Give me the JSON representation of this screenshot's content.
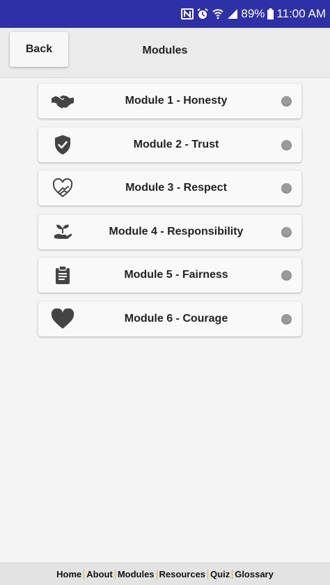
{
  "status_bar": {
    "battery": "89%",
    "time": "11:00 AM",
    "icons": [
      "nfc-icon",
      "alarm-icon",
      "wifi-icon",
      "signal-icon",
      "battery-icon"
    ]
  },
  "header": {
    "back_label": "Back",
    "title": "Modules"
  },
  "modules": [
    {
      "label": "Module 1 - Honesty",
      "icon": "handshake-icon"
    },
    {
      "label": "Module 2 - Trust",
      "icon": "shield-check-icon"
    },
    {
      "label": "Module 3 - Respect",
      "icon": "heart-hand-icon"
    },
    {
      "label": "Module 4 - Responsibility",
      "icon": "sprout-hand-icon"
    },
    {
      "label": "Module 5 - Fairness",
      "icon": "clipboard-icon"
    },
    {
      "label": "Module 6 - Courage",
      "icon": "heart-icon"
    }
  ],
  "footer": {
    "links": [
      "Home",
      "About",
      "Modules",
      "Resources",
      "Quiz",
      "Glossary"
    ]
  },
  "colors": {
    "status_bar": "#2e30a8",
    "icon": "#444444",
    "status_dot": "#9b9b9b",
    "footer_separator": "#d9b43a"
  }
}
